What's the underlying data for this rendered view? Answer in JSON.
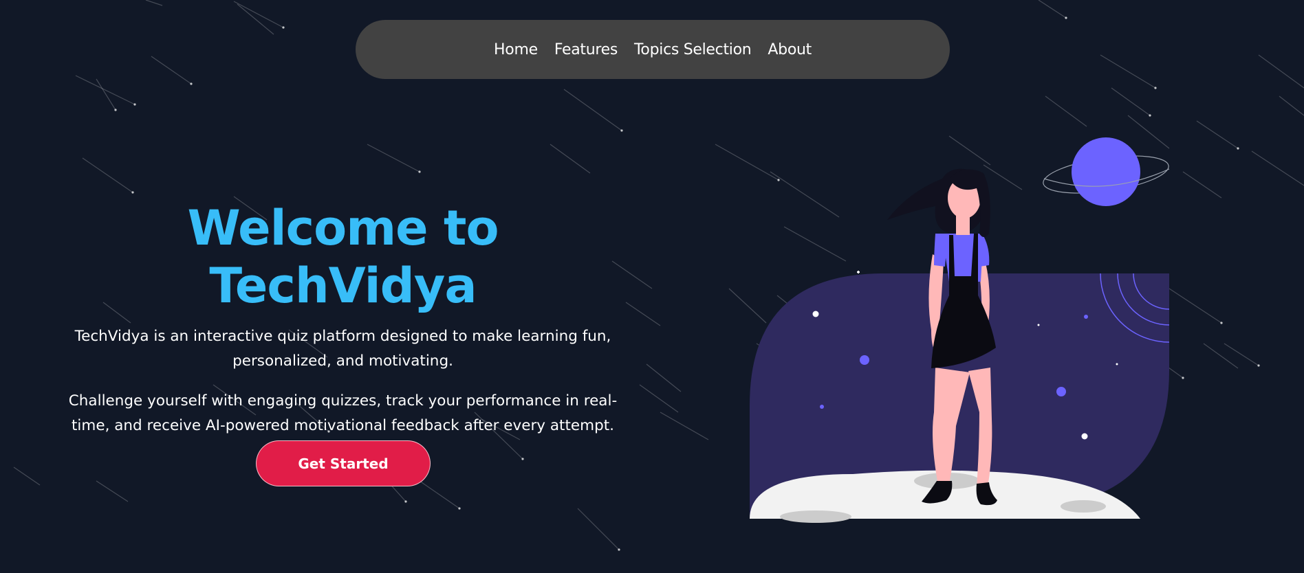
{
  "nav": {
    "items": [
      {
        "label": "Home"
      },
      {
        "label": "Features"
      },
      {
        "label": "Topics Selection"
      },
      {
        "label": "About"
      }
    ]
  },
  "hero": {
    "title": "Welcome to TechVidya",
    "description_1": "TechVidya is an interactive quiz platform designed to make learning fun, personalized, and motivating.",
    "description_2": "Challenge yourself with engaging quizzes, track your performance in real-time, and receive AI-powered motivational feedback after every attempt.",
    "cta_label": "Get Started"
  },
  "illustration": {
    "icon": "girl-standing-on-moon-illustration",
    "colors": {
      "accent": "#6c63ff",
      "panel": "#2f2a5f",
      "moon": "#f2f2f2"
    }
  },
  "colors": {
    "background": "#111827",
    "nav_background": "#424242",
    "title": "#38bdf8",
    "cta": "#e11d48"
  }
}
